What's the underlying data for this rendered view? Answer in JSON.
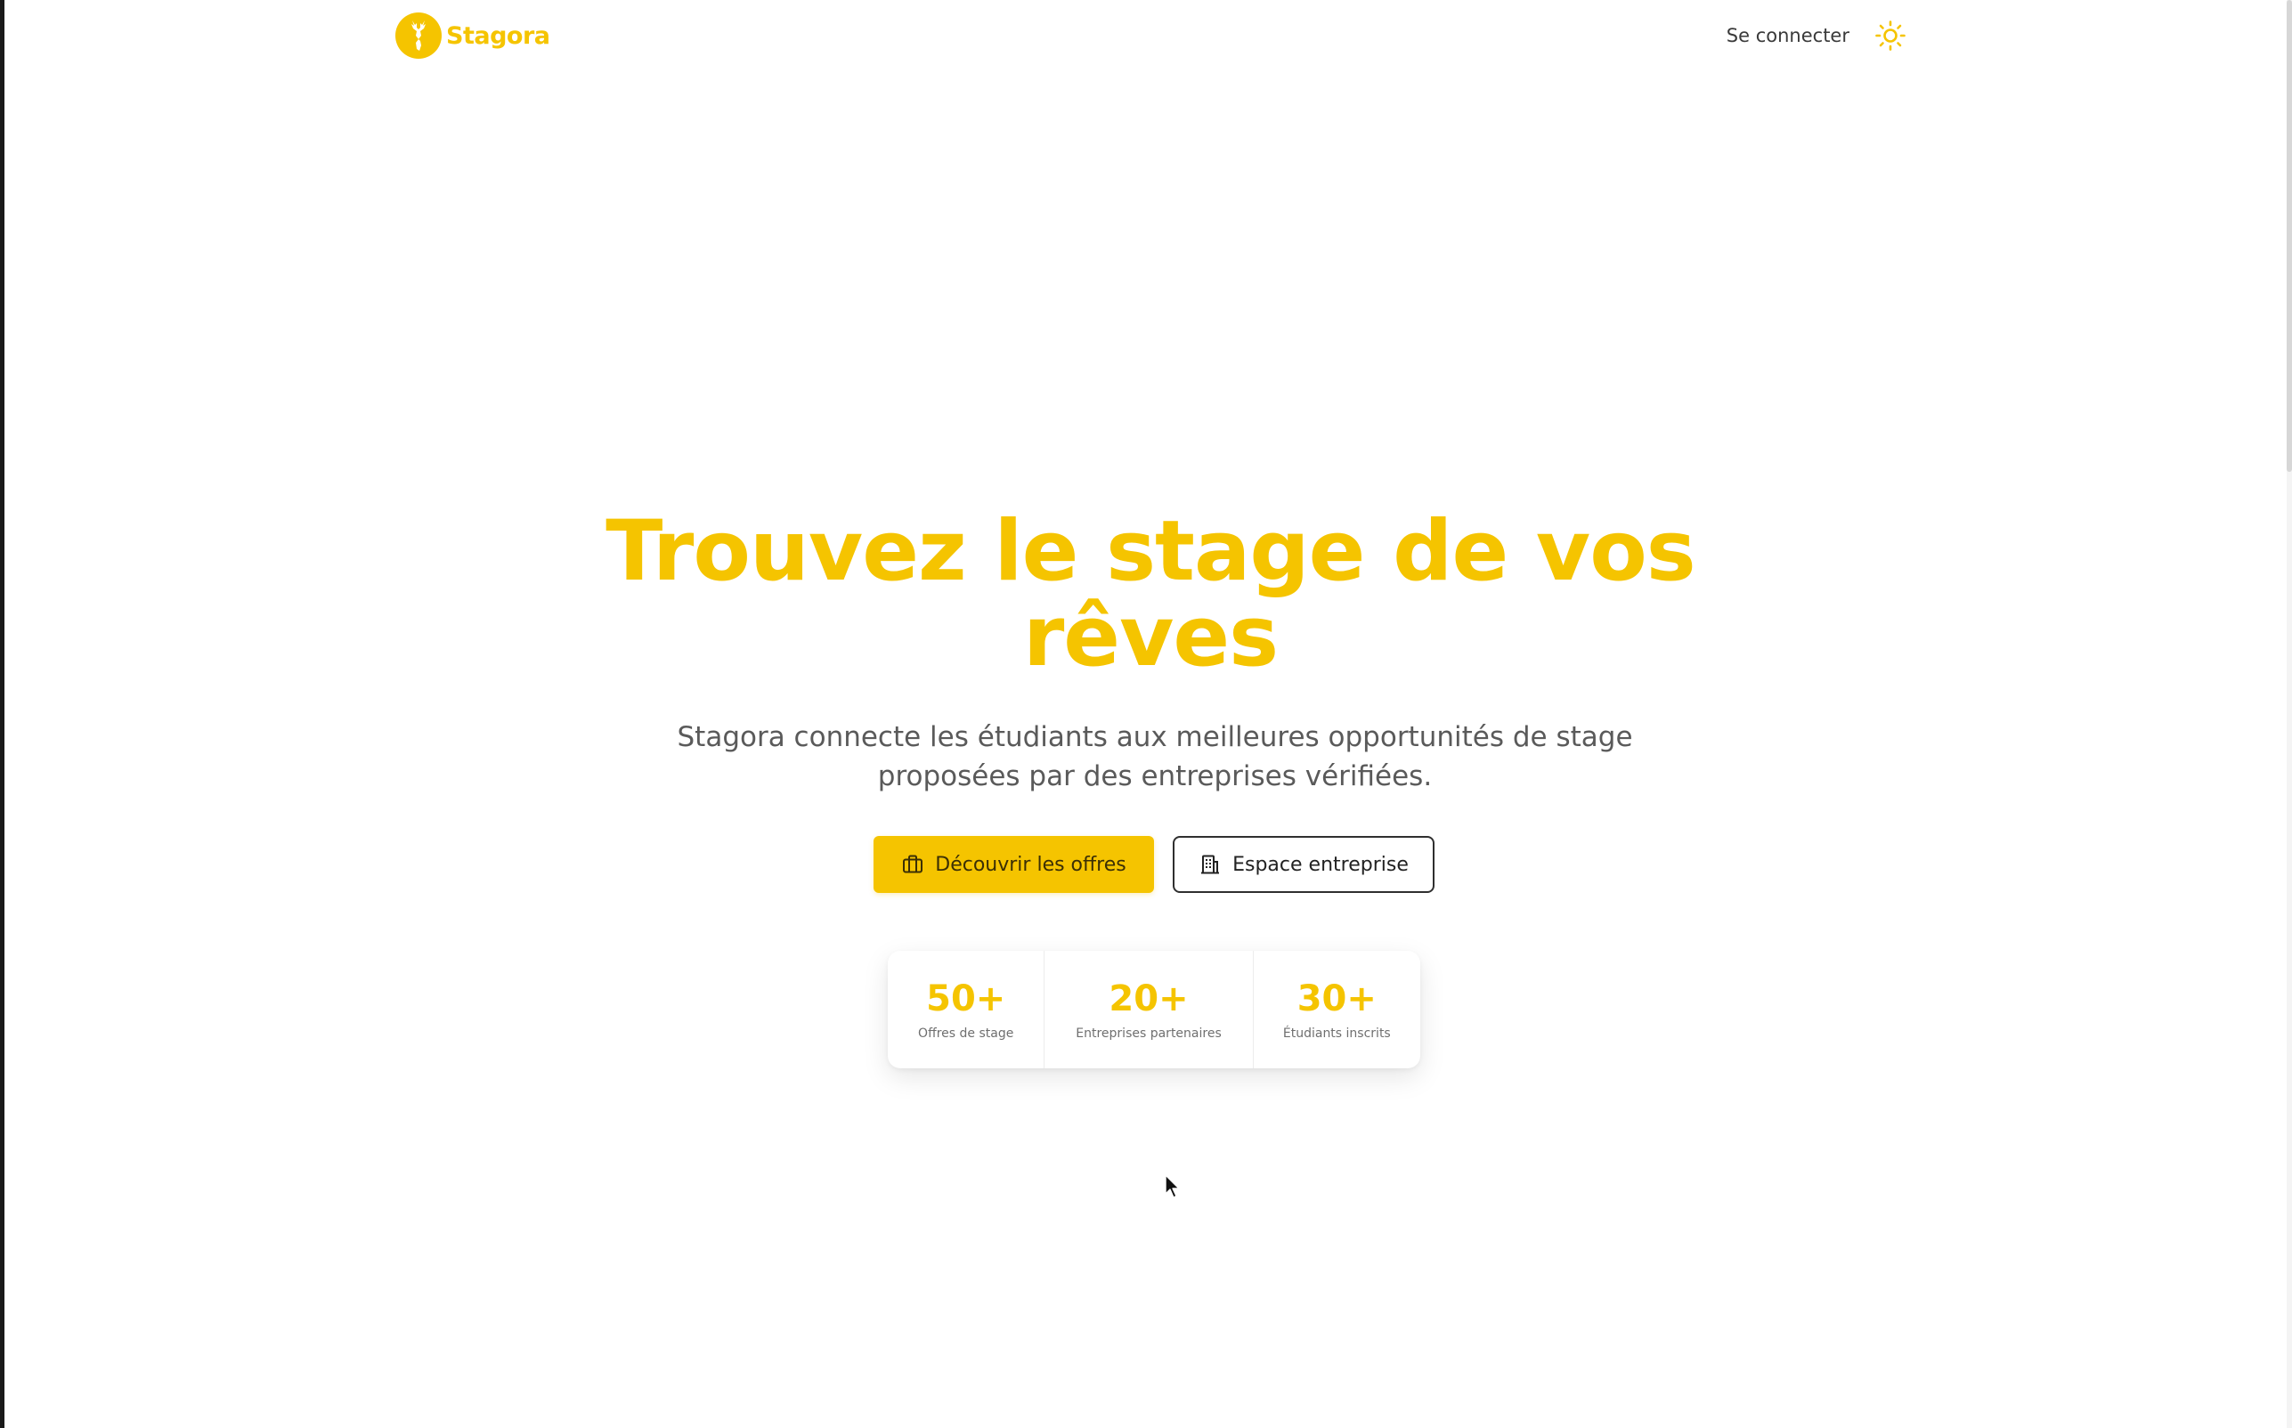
{
  "brand": {
    "name": "Stagora",
    "logo_icon": "deer-icon",
    "accent_color": "#F5C400"
  },
  "header": {
    "login_label": "Se connecter",
    "theme_icon": "sun-icon"
  },
  "hero": {
    "title_line1": "Trouvez le stage de vos",
    "title_line2": "rêves",
    "subtitle_line1": "Stagora connecte les étudiants aux meilleures opportunités de stage",
    "subtitle_line2": "proposées par des entreprises vérifiées.",
    "primary_cta": {
      "label": "Découvrir les offres",
      "icon": "briefcase-icon"
    },
    "secondary_cta": {
      "label": "Espace entreprise",
      "icon": "building-icon"
    }
  },
  "stats": [
    {
      "value": "50+",
      "label": "Offres de stage"
    },
    {
      "value": "20+",
      "label": "Entreprises partenaires"
    },
    {
      "value": "30+",
      "label": "Étudiants inscrits"
    }
  ]
}
